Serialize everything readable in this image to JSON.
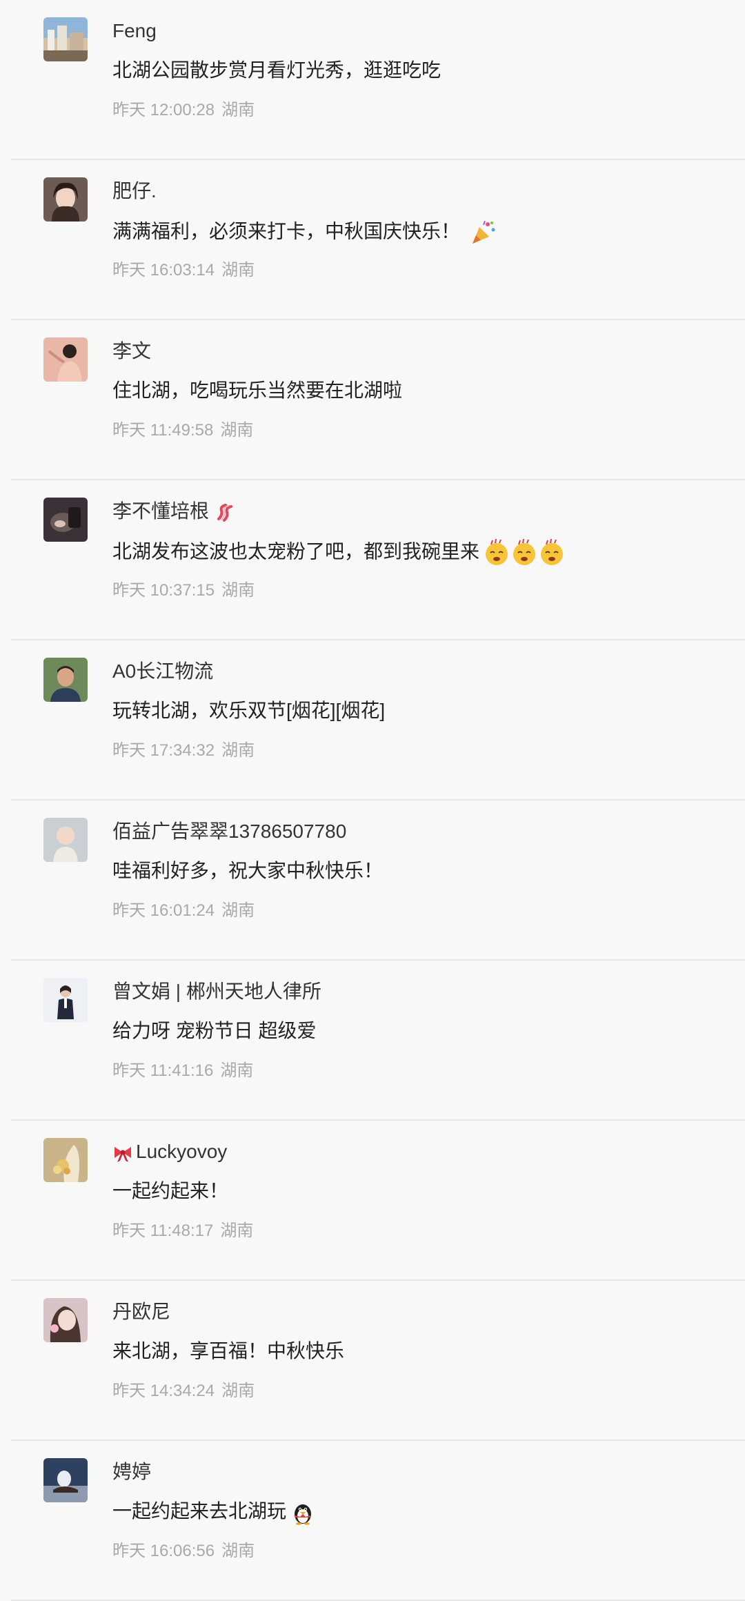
{
  "comments": [
    {
      "name": "Feng",
      "content": "北湖公园散步赏月看灯光秀，逛逛吃吃",
      "time": "昨天 12:00:28",
      "region": "湖南",
      "avatar_icon": "city-photo-icon",
      "avatar_color": "#8fb6d8"
    },
    {
      "name": "肥仔.",
      "content": "满满福利，必须来打卡，中秋国庆快乐！",
      "time": "昨天 16:03:14",
      "region": "湖南",
      "avatar_icon": "portrait-photo-icon",
      "avatar_color": "#6d5a52",
      "content_emoji": "party-popper-icon"
    },
    {
      "name": "李文",
      "content": "住北湖，吃喝玩乐当然要在北湖啦",
      "time": "昨天 11:49:58",
      "region": "湖南",
      "avatar_icon": "illustration-photo-icon",
      "avatar_color": "#e9b7a7"
    },
    {
      "name": "李不懂培根",
      "content": "北湖发布这波也太宠粉了吧，都到我碗里来",
      "time": "昨天 10:37:15",
      "region": "湖南",
      "avatar_icon": "dark-photo-icon",
      "avatar_color": "#3a3236",
      "name_emoji": "bacon-icon",
      "content_emoji": "hungry-face-icon"
    },
    {
      "name": "A0长江物流",
      "content": "玩转北湖，欢乐双节[烟花][烟花]",
      "time": "昨天 17:34:32",
      "region": "湖南",
      "avatar_icon": "man-photo-icon",
      "avatar_color": "#6f8a5a"
    },
    {
      "name": "佰益广告翠翠13786507780",
      "content": "哇福利好多，祝大家中秋快乐！",
      "time": "昨天 16:01:24",
      "region": "湖南",
      "avatar_icon": "baby-photo-icon",
      "avatar_color": "#c9cfd2"
    },
    {
      "name": "曾文娟 | 郴州天地人律所",
      "content": "给力呀 宠粉节日 超级爱",
      "time": "昨天 11:41:16",
      "region": "湖南",
      "avatar_icon": "woman-suit-photo-icon",
      "avatar_color": "#eef0f4"
    },
    {
      "name": "Luckyovoy",
      "content": "一起约起来！",
      "time": "昨天 11:48:17",
      "region": "湖南",
      "avatar_icon": "flowers-photo-icon",
      "avatar_color": "#c9b48a",
      "name_prefix_emoji": "ribbon-icon"
    },
    {
      "name": "丹欧尼",
      "content": "来北湖，享百福！中秋快乐",
      "time": "昨天 14:34:24",
      "region": "湖南",
      "avatar_icon": "girl-photo-icon",
      "avatar_color": "#d8c3c6"
    },
    {
      "name": "娉婷",
      "content": "一起约起来去北湖玩",
      "time": "昨天 16:06:56",
      "region": "湖南",
      "avatar_icon": "night-scene-photo-icon",
      "avatar_color": "#2f4160",
      "content_emoji": "penguin-icon"
    }
  ],
  "colors": {
    "background": "#f8f8f9",
    "divider": "#e6e6e6",
    "name_text": "#333333",
    "content_text": "#222222",
    "meta_text": "#a9a9a9"
  }
}
